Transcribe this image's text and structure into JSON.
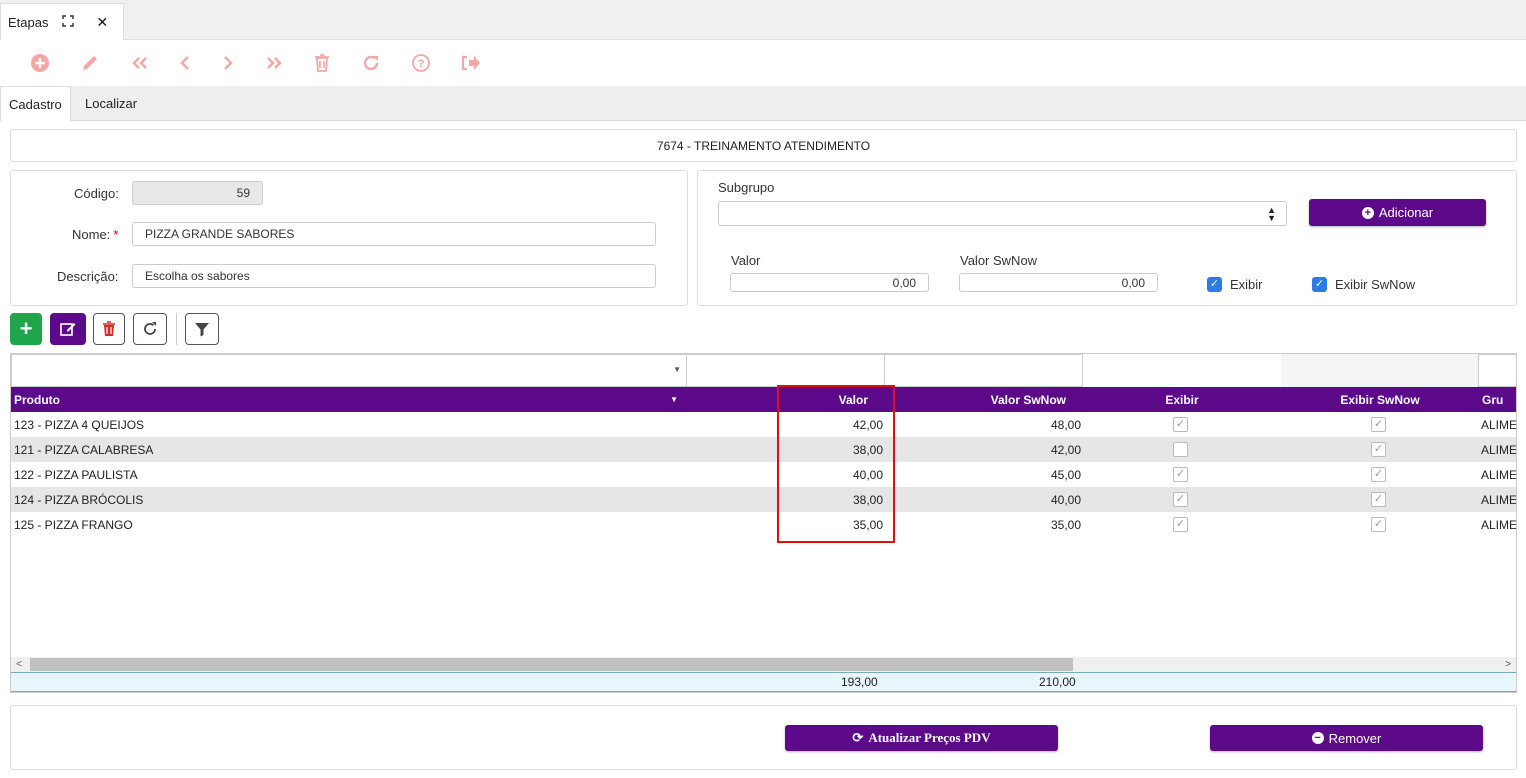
{
  "window_tab": {
    "title": "Etapas"
  },
  "form_tabs": [
    "Cadastro",
    "Localizar"
  ],
  "header": {
    "title": "7674 - TREINAMENTO ATENDIMENTO"
  },
  "form": {
    "codigo_label": "Código:",
    "codigo_value": "59",
    "nome_label": "Nome:",
    "nome_value": "PIZZA GRANDE SABORES",
    "descricao_label": "Descrição:",
    "descricao_value": "Escolha os sabores"
  },
  "subgroup_panel": {
    "subgrupo_label": "Subgrupo",
    "subgrupo_value": "",
    "add_button": "Adicionar",
    "valor_label": "Valor",
    "valor_value": "0,00",
    "valor_swnow_label": "Valor SwNow",
    "valor_swnow_value": "0,00",
    "exibir_label": "Exibir",
    "exibir_checked": true,
    "exibir_swnow_label": "Exibir SwNow",
    "exibir_swnow_checked": true
  },
  "grid": {
    "columns": [
      "Produto",
      "Valor",
      "Valor SwNow",
      "Exibir",
      "Exibir SwNow",
      "Gru"
    ],
    "rows": [
      {
        "produto": "123 - PIZZA 4 QUEIJOS",
        "valor": "42,00",
        "valor_swnow": "48,00",
        "exibir": true,
        "exibir_swnow": true,
        "grupo": "ALIME"
      },
      {
        "produto": "121 - PIZZA CALABRESA",
        "valor": "38,00",
        "valor_swnow": "42,00",
        "exibir": false,
        "exibir_swnow": true,
        "grupo": "ALIME"
      },
      {
        "produto": "122 - PIZZA PAULISTA",
        "valor": "40,00",
        "valor_swnow": "45,00",
        "exibir": true,
        "exibir_swnow": true,
        "grupo": "ALIME"
      },
      {
        "produto": "124 - PIZZA BRÓCOLIS",
        "valor": "38,00",
        "valor_swnow": "40,00",
        "exibir": true,
        "exibir_swnow": true,
        "grupo": "ALIME"
      },
      {
        "produto": "125 - PIZZA FRANGO",
        "valor": "35,00",
        "valor_swnow": "35,00",
        "exibir": true,
        "exibir_swnow": true,
        "grupo": "ALIME"
      }
    ],
    "totals": {
      "valor": "193,00",
      "valor_swnow": "210,00"
    }
  },
  "footer": {
    "update_button": "Atualizar Preços PDV",
    "remove_button": "Remover"
  },
  "colors": {
    "primary": "#5c0a8a",
    "toolbar_icon": "#f4a7a4",
    "add_green": "#1fa64b",
    "highlight": "#e01010"
  }
}
